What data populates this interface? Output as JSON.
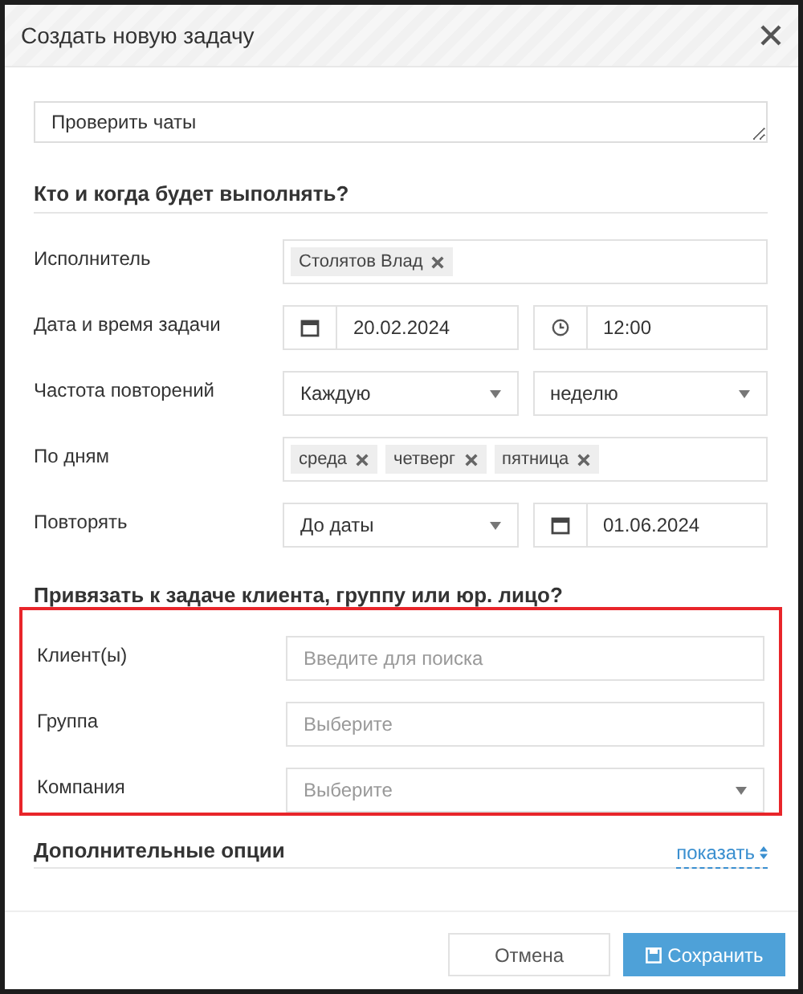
{
  "dialog": {
    "title": "Создать новую задачу"
  },
  "task_text": "Проверить чаты",
  "sections": [
    {
      "heading": "Кто и когда будет выполнять?",
      "highlighted": false,
      "rows": [
        {
          "label": "Исполнитель",
          "controls": [
            {
              "kind": "tags",
              "tags": [
                "Столятов Влад"
              ]
            }
          ]
        },
        {
          "label": "Дата и время задачи",
          "controls": [
            {
              "kind": "date",
              "value": "20.02.2024"
            },
            {
              "kind": "time",
              "value": "12:00"
            }
          ]
        },
        {
          "label": "Частота повторений",
          "controls": [
            {
              "kind": "select",
              "value": "Каждую"
            },
            {
              "kind": "select",
              "value": "неделю"
            }
          ]
        },
        {
          "label": "По дням",
          "controls": [
            {
              "kind": "tags",
              "tags": [
                "среда",
                "четверг",
                "пятница"
              ]
            }
          ]
        },
        {
          "label": "Повторять",
          "controls": [
            {
              "kind": "select",
              "value": "До даты"
            },
            {
              "kind": "date",
              "value": "01.06.2024"
            }
          ]
        }
      ]
    },
    {
      "heading": "Привязать к задаче клиента, группу или юр. лицо?",
      "highlighted": true,
      "rows": [
        {
          "label": "Клиент(ы)",
          "controls": [
            {
              "kind": "text",
              "placeholder": "Введите для поиска"
            }
          ]
        },
        {
          "label": "Группа",
          "controls": [
            {
              "kind": "text",
              "placeholder": "Выберите"
            }
          ]
        },
        {
          "label": "Компания",
          "controls": [
            {
              "kind": "select",
              "placeholder": "Выберите"
            }
          ]
        }
      ]
    }
  ],
  "options": {
    "heading": "Дополнительные опции",
    "toggle": "показать"
  },
  "buttons": [
    {
      "label": "Отмена",
      "kind": "secondary"
    },
    {
      "label": "Сохранить",
      "kind": "primary"
    }
  ]
}
